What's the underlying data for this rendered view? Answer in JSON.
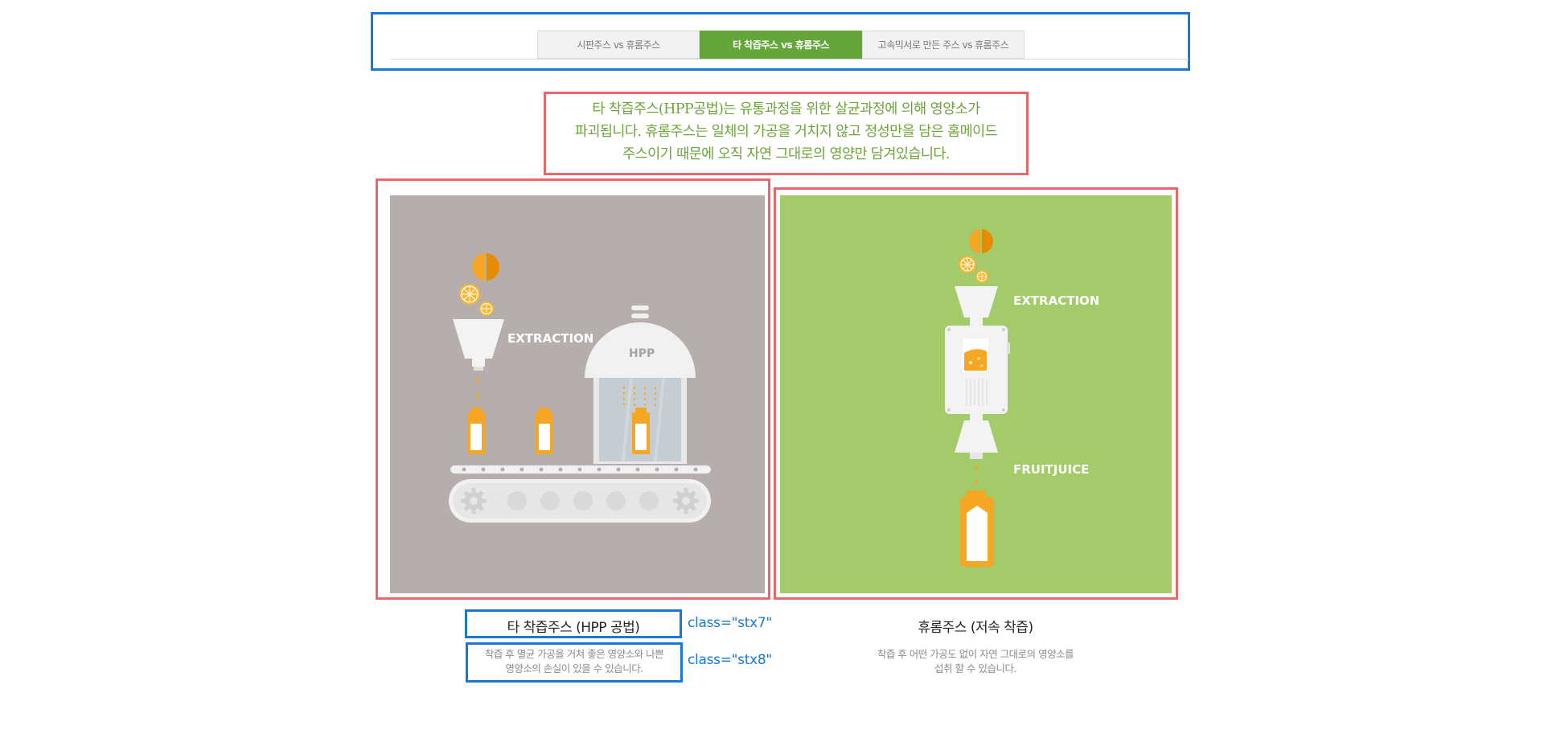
{
  "tabs": [
    {
      "label": "시판주스 vs 휴롬주스",
      "active": false
    },
    {
      "label": "타 착즙주스 vs 휴롬주스",
      "active": true
    },
    {
      "label": "고속믹서로 만든 주스 vs 휴롬주스",
      "active": false
    }
  ],
  "headline": {
    "line1": "타 착즙주스(HPP공법)는 유통과정을 위한 살균과정에 의해 영양소가",
    "line2": "파괴됩니다. 휴롬주스는 일체의 가공을 거치지 않고 정성만을 담은 홈메이드",
    "line3": "주스이기 때문에 오직 자연 그대로의 영양만 담겨있습니다."
  },
  "left_panel": {
    "extraction_label": "EXTRACTION",
    "hpp_label": "HPP",
    "title": "타 착즙주스 (HPP 공법)",
    "desc_line1": "착즙 후 멸균 가공을 거쳐 좋은 영양소와 나쁜",
    "desc_line2": "영양소의 손실이 있을 수 있습니다."
  },
  "right_panel": {
    "extraction_label": "EXTRACTION",
    "fruitjuice_label": "FRUITJUICE",
    "title": "휴롬주스 (저속 착즙)",
    "desc_line1": "착즙 후 어떤 가공도 없이 자연 그대로의 영양소를",
    "desc_line2": "섭취 할 수 있습니다."
  },
  "annotations": {
    "title_class": "class=\"stx7\"",
    "desc_class": "class=\"stx8\""
  },
  "colors": {
    "accent_green": "#64a63a",
    "headline_green": "#6da43a",
    "panel_gray": "#b5aeac",
    "panel_green": "#a3cb6a",
    "orange": "#f39a12",
    "annotation_blue": "#1a78d2",
    "annotation_red": "#e8676a"
  }
}
